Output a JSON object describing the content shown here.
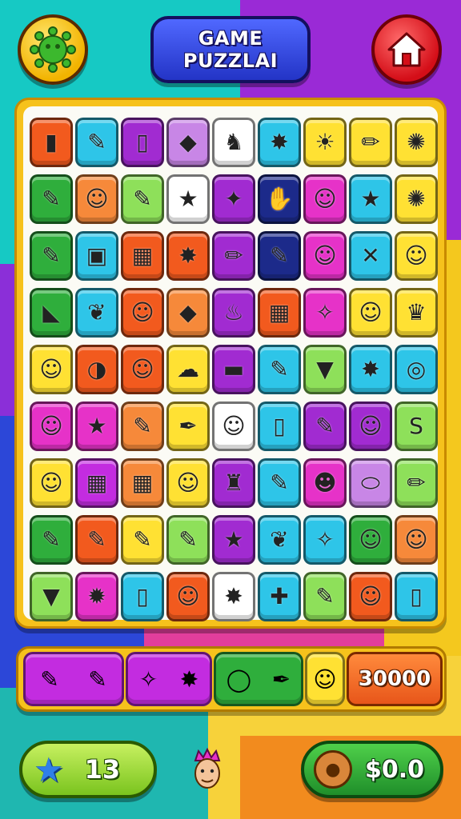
{
  "header": {
    "title_line1": "GAME",
    "title_line2": "PUZZLAI",
    "left_button_icon": "green-virus-icon",
    "right_button_icon": "home-icon"
  },
  "board": {
    "rows": [
      [
        {
          "c": "#f25a1e",
          "i": "▮",
          "n": "green-block"
        },
        {
          "c": "#2ec5e8",
          "i": "✎",
          "n": "pencil"
        },
        {
          "c": "#a12bd1",
          "i": "▯",
          "n": "jar"
        },
        {
          "c": "#c886e6",
          "i": "◆",
          "n": "crystal"
        },
        {
          "c": "#ffffff",
          "i": "♞",
          "n": "boot"
        },
        {
          "c": "#2ec5e8",
          "i": "✸",
          "n": "splat"
        },
        {
          "c": "#ffe133",
          "i": "☀",
          "n": "sun-germ"
        },
        {
          "c": "#ffe133",
          "i": "✏",
          "n": "purple-pencil"
        },
        {
          "c": "#ffe133",
          "i": "✺",
          "n": "blue-germ"
        }
      ],
      [
        {
          "c": "#2fae3c",
          "i": "✎",
          "n": "crayon"
        },
        {
          "c": "#f6893a",
          "i": "☺",
          "n": "monkey"
        },
        {
          "c": "#8ee05a",
          "i": "✎",
          "n": "green-crayon"
        },
        {
          "c": "#ffffff",
          "i": "★",
          "n": "orange-star-face"
        },
        {
          "c": "#a12bd1",
          "i": "✦",
          "n": "purple-hand"
        },
        {
          "c": "#1c2a8a",
          "i": "✋",
          "n": "yellow-hand"
        },
        {
          "c": "#e632c8",
          "i": "☺",
          "n": "face"
        },
        {
          "c": "#2ec5e8",
          "i": "★",
          "n": "gold-star"
        },
        {
          "c": "#ffe133",
          "i": "✺",
          "n": "green-germ"
        }
      ],
      [
        {
          "c": "#2fae3c",
          "i": "✎",
          "n": "crayon"
        },
        {
          "c": "#2ec5e8",
          "i": "▣",
          "n": "box"
        },
        {
          "c": "#f25a1e",
          "i": "▦",
          "n": "calendar"
        },
        {
          "c": "#f25a1e",
          "i": "✸",
          "n": "yellow-splat"
        },
        {
          "c": "#a12bd1",
          "i": "✏",
          "n": "yellow-pencil"
        },
        {
          "c": "#1c2a8a",
          "i": "✎",
          "n": "orange-pencil"
        },
        {
          "c": "#e632c8",
          "i": "☺",
          "n": "pink-hair-face"
        },
        {
          "c": "#2ec5e8",
          "i": "✕",
          "n": "compass"
        },
        {
          "c": "#ffe133",
          "i": "☺",
          "n": "face"
        }
      ],
      [
        {
          "c": "#2fae3c",
          "i": "◣",
          "n": "flag"
        },
        {
          "c": "#2ec5e8",
          "i": "❦",
          "n": "leaf"
        },
        {
          "c": "#f25a1e",
          "i": "☺",
          "n": "face"
        },
        {
          "c": "#f6893a",
          "i": "◆",
          "n": "crystal"
        },
        {
          "c": "#a12bd1",
          "i": "♨",
          "n": "squid"
        },
        {
          "c": "#f25a1e",
          "i": "▦",
          "n": "calculator"
        },
        {
          "c": "#e632c8",
          "i": "✧",
          "n": "wand"
        },
        {
          "c": "#ffe133",
          "i": "☺",
          "n": "face"
        },
        {
          "c": "#ffe133",
          "i": "♛",
          "n": "hat"
        }
      ],
      [
        {
          "c": "#ffe133",
          "i": "☺",
          "n": "face"
        },
        {
          "c": "#f25a1e",
          "i": "◑",
          "n": "ball"
        },
        {
          "c": "#f25a1e",
          "i": "☺",
          "n": "face"
        },
        {
          "c": "#ffe133",
          "i": "☁",
          "n": "tree"
        },
        {
          "c": "#a12bd1",
          "i": "▬",
          "n": "brick"
        },
        {
          "c": "#2ec5e8",
          "i": "✎",
          "n": "yellow-crayon"
        },
        {
          "c": "#8ee05a",
          "i": "▼",
          "n": "cone"
        },
        {
          "c": "#2ec5e8",
          "i": "✸",
          "n": "orange-splat"
        },
        {
          "c": "#2ec5e8",
          "i": "◎",
          "n": "spiral"
        }
      ],
      [
        {
          "c": "#e632c8",
          "i": "☺",
          "n": "face"
        },
        {
          "c": "#e632c8",
          "i": "★",
          "n": "star"
        },
        {
          "c": "#f6893a",
          "i": "✎",
          "n": "pencil"
        },
        {
          "c": "#ffe133",
          "i": "✒",
          "n": "marker"
        },
        {
          "c": "#ffffff",
          "i": "☺",
          "n": "face"
        },
        {
          "c": "#2ec5e8",
          "i": "▯",
          "n": "jar"
        },
        {
          "c": "#a12bd1",
          "i": "✎",
          "n": "crayon"
        },
        {
          "c": "#a12bd1",
          "i": "☺",
          "n": "face"
        },
        {
          "c": "#8ee05a",
          "i": "S",
          "n": "worm"
        }
      ],
      [
        {
          "c": "#ffe133",
          "i": "☺",
          "n": "face"
        },
        {
          "c": "#c32ce0",
          "i": "▦",
          "n": "calculator"
        },
        {
          "c": "#f6893a",
          "i": "▦",
          "n": "calendar"
        },
        {
          "c": "#ffe133",
          "i": "☺",
          "n": "face"
        },
        {
          "c": "#a12bd1",
          "i": "♜",
          "n": "trash"
        },
        {
          "c": "#2ec5e8",
          "i": "✎",
          "n": "crayon"
        },
        {
          "c": "#e632c8",
          "i": "☻",
          "n": "panda"
        },
        {
          "c": "#c886e6",
          "i": "⬭",
          "n": "bean"
        },
        {
          "c": "#8ee05a",
          "i": "✏",
          "n": "pencil"
        }
      ],
      [
        {
          "c": "#2fae3c",
          "i": "✎",
          "n": "purple-crayon"
        },
        {
          "c": "#f25a1e",
          "i": "✎",
          "n": "pencil"
        },
        {
          "c": "#ffe133",
          "i": "✎",
          "n": "stick"
        },
        {
          "c": "#8ee05a",
          "i": "✎",
          "n": "grey-crayon"
        },
        {
          "c": "#a12bd1",
          "i": "★",
          "n": "blue-star"
        },
        {
          "c": "#2ec5e8",
          "i": "❦",
          "n": "leaf"
        },
        {
          "c": "#2ec5e8",
          "i": "✧",
          "n": "wand"
        },
        {
          "c": "#2fae3c",
          "i": "☺",
          "n": "face"
        },
        {
          "c": "#f6893a",
          "i": "☺",
          "n": "face"
        }
      ],
      [
        {
          "c": "#8ee05a",
          "i": "▼",
          "n": "cone"
        },
        {
          "c": "#e632c8",
          "i": "✹",
          "n": "sun-badge"
        },
        {
          "c": "#2ec5e8",
          "i": "▯",
          "n": "jar"
        },
        {
          "c": "#f25a1e",
          "i": "☺",
          "n": "skull"
        },
        {
          "c": "#ffffff",
          "i": "✸",
          "n": "orange-splat"
        },
        {
          "c": "#2ec5e8",
          "i": "✚",
          "n": "medicine"
        },
        {
          "c": "#8ee05a",
          "i": "✎",
          "n": "purple-crayon"
        },
        {
          "c": "#f25a1e",
          "i": "☺",
          "n": "star-face"
        },
        {
          "c": "#2ec5e8",
          "i": "▯",
          "n": "cup"
        }
      ]
    ]
  },
  "inventory": {
    "slot1": [
      "✎",
      "✎"
    ],
    "slot2": [
      "✧",
      "✸"
    ],
    "slot3": [
      "◯",
      "✒"
    ],
    "slot4": [
      "☺"
    ],
    "score": "30000"
  },
  "footer": {
    "stars_icon": "blue-star-icon",
    "stars_count": "13",
    "avatar_icon": "player-avatar-icon",
    "coin_icon": "coin-icon",
    "money": "$0.0"
  }
}
